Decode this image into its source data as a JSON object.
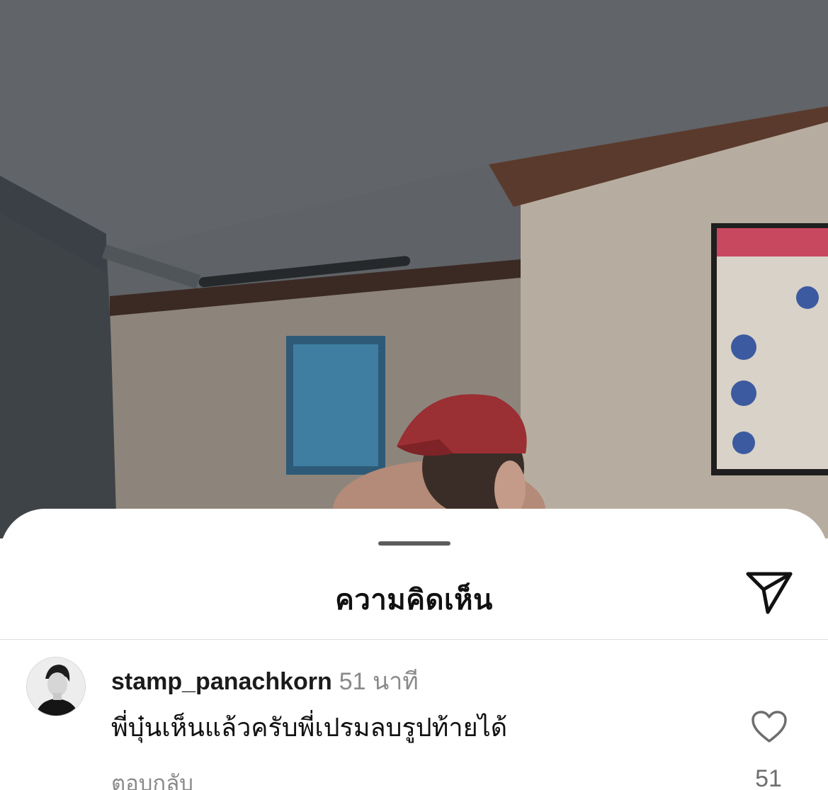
{
  "sheet": {
    "title": "ความคิดเห็น",
    "share_icon": "send-icon"
  },
  "comment": {
    "username": "stamp_panachkorn",
    "time": "51 นาที",
    "text": "พี่บุ๋นเห็นแล้วครับพี่เปรมลบรูปท้ายได้",
    "reply_label": "ตอบกลับ",
    "like_icon": "heart-outline-icon",
    "like_count": "51"
  },
  "colors": {
    "sheet_background": "#ffffff",
    "title_text": "#111111",
    "secondary_text": "#8a8a8a",
    "grabber": "#5c5c5c"
  }
}
